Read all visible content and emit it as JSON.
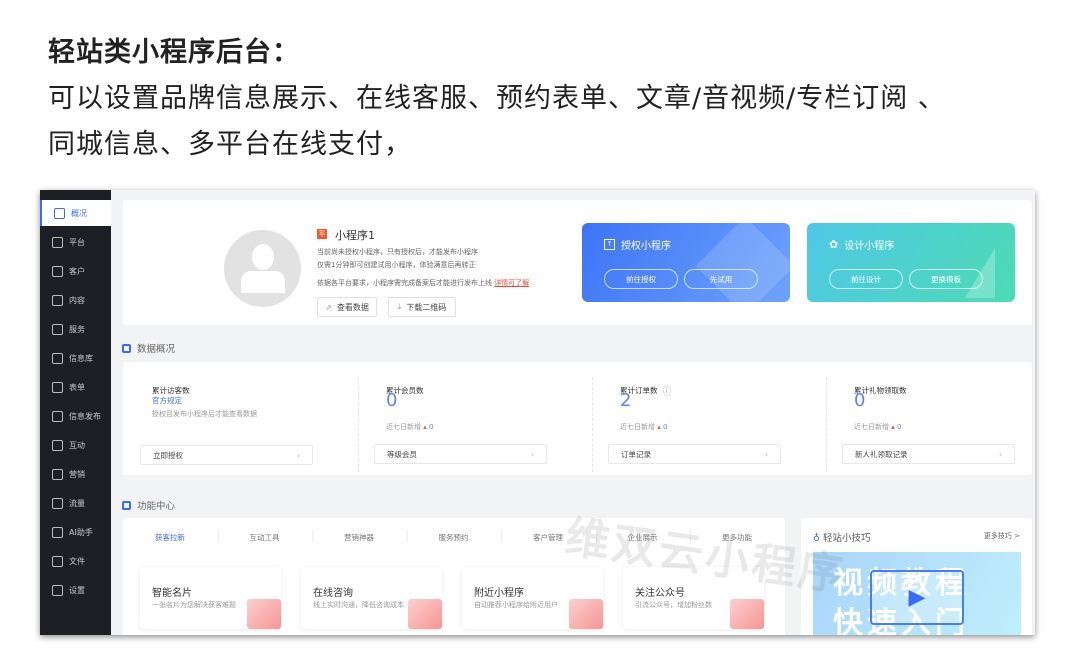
{
  "heading": {
    "line1": "轻站类小程序后台：",
    "line2": "可以设置品牌信息展示、在线客服、预约表单、文章/音视频/专栏订阅 、",
    "line3": "同城信息、多平台在线支付，"
  },
  "sidebar": {
    "items": [
      {
        "label": "概况",
        "icon": "chart-icon"
      },
      {
        "label": "平台",
        "icon": "layers-icon"
      },
      {
        "label": "客户",
        "icon": "user-icon"
      },
      {
        "label": "内容",
        "icon": "document-icon"
      },
      {
        "label": "服务",
        "icon": "service-icon"
      },
      {
        "label": "信息库",
        "icon": "message-icon"
      },
      {
        "label": "表单",
        "icon": "clipboard-icon"
      },
      {
        "label": "信息发布",
        "icon": "publish-icon"
      },
      {
        "label": "互动",
        "icon": "interact-icon"
      },
      {
        "label": "营销",
        "icon": "tag-icon"
      },
      {
        "label": "流量",
        "icon": "megaphone-icon"
      },
      {
        "label": "AI助手",
        "icon": "robot-icon"
      },
      {
        "label": "文件",
        "icon": "folder-icon"
      },
      {
        "label": "设置",
        "icon": "gear-icon"
      }
    ]
  },
  "profile": {
    "badge": "平",
    "name": "小程序1",
    "line1": "当前尚未授权小程序，只有授权后，才能发布小程序",
    "line2": "仅需1分钟即可创建试用小程序，体验满意后再转正",
    "line3": "依据各平台要求，小程序需完成备案后才能进行发布上线",
    "link": "详情可了解",
    "btn_data": "查看数据",
    "btn_qr": "下载二维码"
  },
  "promo": {
    "auth": {
      "title": "授权小程序",
      "btn1": "前往授权",
      "btn2": "先试用"
    },
    "design": {
      "title": "设计小程序",
      "btn1": "前往设计",
      "btn2": "更换模板"
    }
  },
  "data_overview": {
    "title": "数据概况",
    "stats": [
      {
        "label": "累计访客数",
        "link": "官方规定",
        "note": "授权且发布小程序后才能查看数据",
        "action": "立即授权"
      },
      {
        "label": "累计会员数",
        "value": "0",
        "recent_label": "近七日新增",
        "recent": "0",
        "action": "等级会员"
      },
      {
        "label": "累计订单数",
        "value": "2",
        "recent_label": "近七日新增",
        "recent": "0",
        "action": "订单记录"
      },
      {
        "label": "累计礼物领取数",
        "value": "0",
        "recent_label": "近七日新增",
        "recent": "0",
        "action": "新人礼领取记录"
      }
    ]
  },
  "function_center": {
    "title": "功能中心",
    "tabs": [
      "获客拉新",
      "互动工具",
      "营销神器",
      "服务预约",
      "客户管理",
      "企业展示",
      "更多功能"
    ],
    "cards": [
      {
        "name": "智能名片",
        "desc": "一张名片为您解决获客难题"
      },
      {
        "name": "在线咨询",
        "desc": "线上实时沟通，降低咨询成本"
      },
      {
        "name": "附近小程序",
        "desc": "自动推荐小程序给附近用户"
      },
      {
        "name": "关注公众号",
        "desc": "引流公众号，增加粉丝数"
      }
    ]
  },
  "tips": {
    "title": "轻站小技巧",
    "more": "更多技巧 >",
    "video_text1": "视频教程",
    "video_text2": "快速入门"
  },
  "watermark": "维双云小程序",
  "colors": {
    "accent": "#3b6cf6",
    "sidebar": "#1e1f24",
    "red": "#f25a2c"
  }
}
